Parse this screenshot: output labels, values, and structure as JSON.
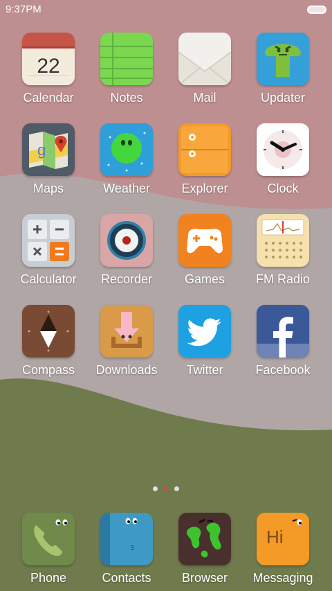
{
  "status_bar": {
    "time": "9:37PM",
    "battery_icon": "battery-icon"
  },
  "colors": {
    "wallpaper_top": "#be8f90",
    "wallpaper_mid": "#b0a6a6",
    "wallpaper_bottom": "#6f7b4d",
    "active_page_dot": "#c0504d",
    "label": "#ffffff"
  },
  "apps": {
    "calendar": {
      "label": "Calendar",
      "date": "22",
      "icon": "calendar-icon"
    },
    "notes": {
      "label": "Notes",
      "icon": "notes-icon"
    },
    "mail": {
      "label": "Mail",
      "icon": "mail-icon"
    },
    "updater": {
      "label": "Updater",
      "icon": "updater-icon"
    },
    "maps": {
      "label": "Maps",
      "icon": "maps-icon"
    },
    "weather": {
      "label": "Weather",
      "icon": "weather-icon"
    },
    "explorer": {
      "label": "Explorer",
      "icon": "explorer-icon"
    },
    "clock": {
      "label": "Clock",
      "icon": "clock-icon"
    },
    "calculator": {
      "label": "Calculator",
      "icon": "calculator-icon"
    },
    "recorder": {
      "label": "Recorder",
      "icon": "recorder-icon"
    },
    "games": {
      "label": "Games",
      "icon": "games-icon"
    },
    "fmradio": {
      "label": "FM Radio",
      "icon": "fm-radio-icon"
    },
    "compass": {
      "label": "Compass",
      "icon": "compass-icon"
    },
    "downloads": {
      "label": "Downloads",
      "icon": "downloads-icon"
    },
    "twitter": {
      "label": "Twitter",
      "icon": "twitter-icon"
    },
    "facebook": {
      "label": "Facebook",
      "icon": "facebook-icon"
    }
  },
  "dock": {
    "phone": {
      "label": "Phone",
      "icon": "phone-icon"
    },
    "contacts": {
      "label": "Contacts",
      "badge": "3",
      "icon": "contacts-icon"
    },
    "browser": {
      "label": "Browser",
      "icon": "browser-icon"
    },
    "messaging": {
      "label": "Messaging",
      "text": "Hi",
      "icon": "messaging-icon"
    }
  },
  "pagination": {
    "pages": 3,
    "current": 2
  }
}
